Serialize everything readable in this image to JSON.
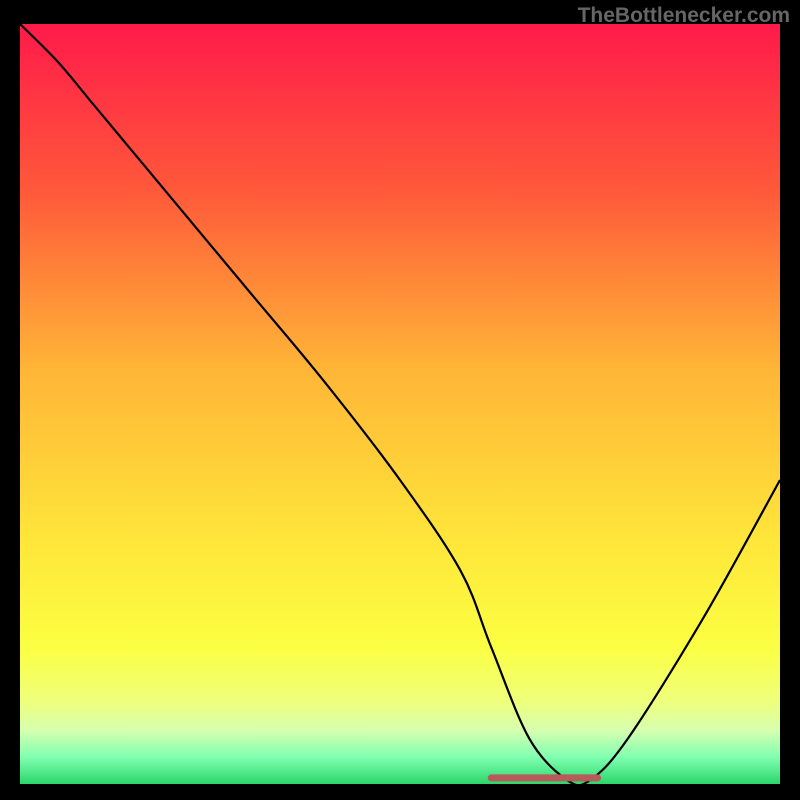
{
  "watermark": "TheBottlenecker.com",
  "chart_data": {
    "type": "line",
    "title": "",
    "xlabel": "",
    "ylabel": "",
    "xlim": [
      0,
      100
    ],
    "ylim": [
      0,
      100
    ],
    "gradient_stops": [
      {
        "offset": 0,
        "color": "#ff1a4a"
      },
      {
        "offset": 22,
        "color": "#ff593a"
      },
      {
        "offset": 45,
        "color": "#ffb437"
      },
      {
        "offset": 68,
        "color": "#ffe63a"
      },
      {
        "offset": 82,
        "color": "#fbff42"
      },
      {
        "offset": 89,
        "color": "#efff7a"
      },
      {
        "offset": 93,
        "color": "#d5ffb0"
      },
      {
        "offset": 96.5,
        "color": "#7fffb0"
      },
      {
        "offset": 100,
        "color": "#2bd66a"
      }
    ],
    "series": [
      {
        "name": "bottleneck-curve",
        "color": "#000000",
        "x": [
          0,
          5,
          10,
          20,
          30,
          40,
          50,
          58,
          62,
          67,
          72,
          75,
          80,
          90,
          100
        ],
        "y": [
          100,
          95,
          89,
          77,
          65,
          53,
          40,
          28,
          18,
          6,
          0.5,
          0.5,
          6,
          22,
          40
        ]
      }
    ],
    "flat_zone": {
      "name": "optimal-range",
      "color": "#b85a5a",
      "x_start": 62,
      "x_end": 76,
      "y": 0.8
    }
  }
}
